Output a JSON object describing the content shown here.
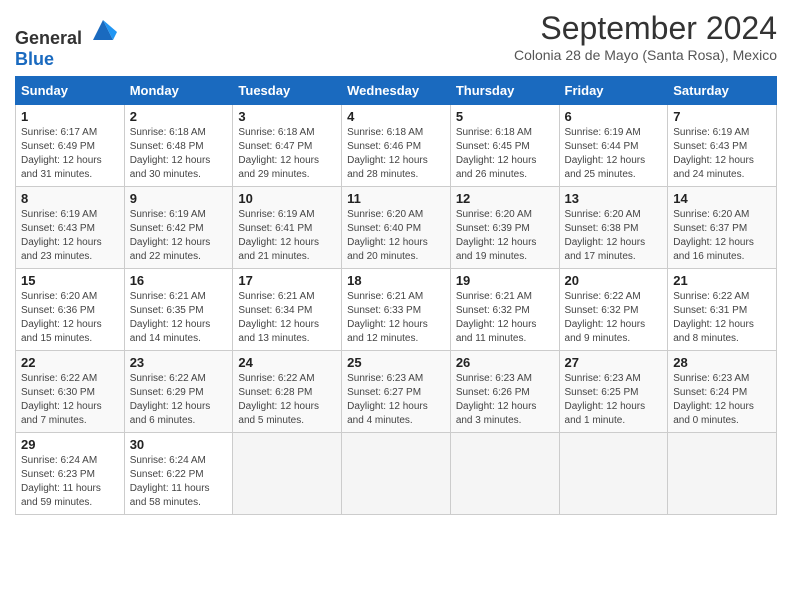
{
  "header": {
    "logo_general": "General",
    "logo_blue": "Blue",
    "month_title": "September 2024",
    "subtitle": "Colonia 28 de Mayo (Santa Rosa), Mexico"
  },
  "weekdays": [
    "Sunday",
    "Monday",
    "Tuesday",
    "Wednesday",
    "Thursday",
    "Friday",
    "Saturday"
  ],
  "weeks": [
    [
      {
        "day": "1",
        "info": "Sunrise: 6:17 AM\nSunset: 6:49 PM\nDaylight: 12 hours\nand 31 minutes."
      },
      {
        "day": "2",
        "info": "Sunrise: 6:18 AM\nSunset: 6:48 PM\nDaylight: 12 hours\nand 30 minutes."
      },
      {
        "day": "3",
        "info": "Sunrise: 6:18 AM\nSunset: 6:47 PM\nDaylight: 12 hours\nand 29 minutes."
      },
      {
        "day": "4",
        "info": "Sunrise: 6:18 AM\nSunset: 6:46 PM\nDaylight: 12 hours\nand 28 minutes."
      },
      {
        "day": "5",
        "info": "Sunrise: 6:18 AM\nSunset: 6:45 PM\nDaylight: 12 hours\nand 26 minutes."
      },
      {
        "day": "6",
        "info": "Sunrise: 6:19 AM\nSunset: 6:44 PM\nDaylight: 12 hours\nand 25 minutes."
      },
      {
        "day": "7",
        "info": "Sunrise: 6:19 AM\nSunset: 6:43 PM\nDaylight: 12 hours\nand 24 minutes."
      }
    ],
    [
      {
        "day": "8",
        "info": "Sunrise: 6:19 AM\nSunset: 6:43 PM\nDaylight: 12 hours\nand 23 minutes."
      },
      {
        "day": "9",
        "info": "Sunrise: 6:19 AM\nSunset: 6:42 PM\nDaylight: 12 hours\nand 22 minutes."
      },
      {
        "day": "10",
        "info": "Sunrise: 6:19 AM\nSunset: 6:41 PM\nDaylight: 12 hours\nand 21 minutes."
      },
      {
        "day": "11",
        "info": "Sunrise: 6:20 AM\nSunset: 6:40 PM\nDaylight: 12 hours\nand 20 minutes."
      },
      {
        "day": "12",
        "info": "Sunrise: 6:20 AM\nSunset: 6:39 PM\nDaylight: 12 hours\nand 19 minutes."
      },
      {
        "day": "13",
        "info": "Sunrise: 6:20 AM\nSunset: 6:38 PM\nDaylight: 12 hours\nand 17 minutes."
      },
      {
        "day": "14",
        "info": "Sunrise: 6:20 AM\nSunset: 6:37 PM\nDaylight: 12 hours\nand 16 minutes."
      }
    ],
    [
      {
        "day": "15",
        "info": "Sunrise: 6:20 AM\nSunset: 6:36 PM\nDaylight: 12 hours\nand 15 minutes."
      },
      {
        "day": "16",
        "info": "Sunrise: 6:21 AM\nSunset: 6:35 PM\nDaylight: 12 hours\nand 14 minutes."
      },
      {
        "day": "17",
        "info": "Sunrise: 6:21 AM\nSunset: 6:34 PM\nDaylight: 12 hours\nand 13 minutes."
      },
      {
        "day": "18",
        "info": "Sunrise: 6:21 AM\nSunset: 6:33 PM\nDaylight: 12 hours\nand 12 minutes."
      },
      {
        "day": "19",
        "info": "Sunrise: 6:21 AM\nSunset: 6:32 PM\nDaylight: 12 hours\nand 11 minutes."
      },
      {
        "day": "20",
        "info": "Sunrise: 6:22 AM\nSunset: 6:32 PM\nDaylight: 12 hours\nand 9 minutes."
      },
      {
        "day": "21",
        "info": "Sunrise: 6:22 AM\nSunset: 6:31 PM\nDaylight: 12 hours\nand 8 minutes."
      }
    ],
    [
      {
        "day": "22",
        "info": "Sunrise: 6:22 AM\nSunset: 6:30 PM\nDaylight: 12 hours\nand 7 minutes."
      },
      {
        "day": "23",
        "info": "Sunrise: 6:22 AM\nSunset: 6:29 PM\nDaylight: 12 hours\nand 6 minutes."
      },
      {
        "day": "24",
        "info": "Sunrise: 6:22 AM\nSunset: 6:28 PM\nDaylight: 12 hours\nand 5 minutes."
      },
      {
        "day": "25",
        "info": "Sunrise: 6:23 AM\nSunset: 6:27 PM\nDaylight: 12 hours\nand 4 minutes."
      },
      {
        "day": "26",
        "info": "Sunrise: 6:23 AM\nSunset: 6:26 PM\nDaylight: 12 hours\nand 3 minutes."
      },
      {
        "day": "27",
        "info": "Sunrise: 6:23 AM\nSunset: 6:25 PM\nDaylight: 12 hours\nand 1 minute."
      },
      {
        "day": "28",
        "info": "Sunrise: 6:23 AM\nSunset: 6:24 PM\nDaylight: 12 hours\nand 0 minutes."
      }
    ],
    [
      {
        "day": "29",
        "info": "Sunrise: 6:24 AM\nSunset: 6:23 PM\nDaylight: 11 hours\nand 59 minutes."
      },
      {
        "day": "30",
        "info": "Sunrise: 6:24 AM\nSunset: 6:22 PM\nDaylight: 11 hours\nand 58 minutes."
      },
      {
        "day": "",
        "info": ""
      },
      {
        "day": "",
        "info": ""
      },
      {
        "day": "",
        "info": ""
      },
      {
        "day": "",
        "info": ""
      },
      {
        "day": "",
        "info": ""
      }
    ]
  ]
}
